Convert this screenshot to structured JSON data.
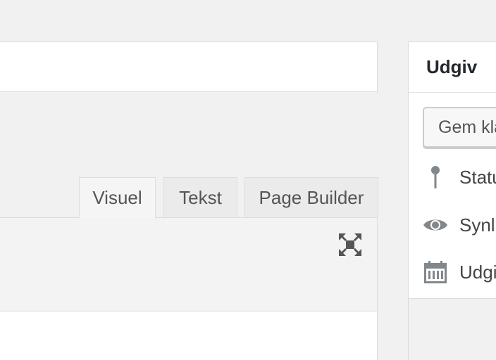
{
  "editor": {
    "title_value": "",
    "tabs": [
      {
        "label": "Visuel",
        "active": true
      },
      {
        "label": "Tekst",
        "active": false
      },
      {
        "label": "Page Builder",
        "active": false
      }
    ],
    "expand_icon": "fullscreen-expand-icon"
  },
  "publish": {
    "title": "Udgiv",
    "save_draft_label": "Gem kladde",
    "rows": [
      {
        "icon": "pin-icon",
        "label": "Status"
      },
      {
        "icon": "eye-icon",
        "label": "Synlighed"
      },
      {
        "icon": "calendar-icon",
        "label": "Udgiv"
      }
    ]
  },
  "colors": {
    "background": "#f1f1f1",
    "border": "#dcdcdc",
    "icon": "#82878c"
  }
}
